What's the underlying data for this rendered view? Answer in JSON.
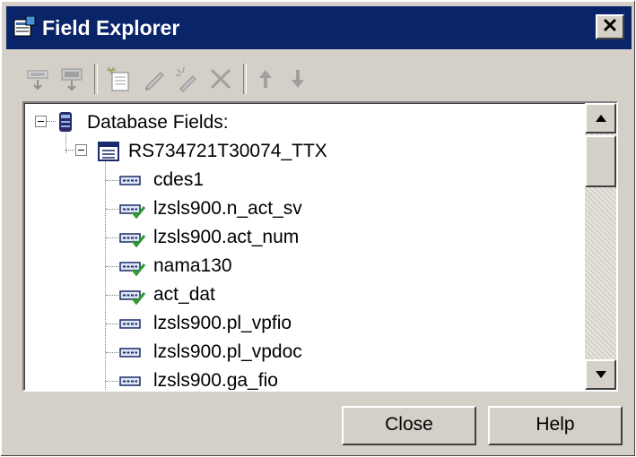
{
  "window": {
    "title": "Field Explorer",
    "close_glyph": "✕"
  },
  "toolbar": {
    "buttons": [
      {
        "name": "insert-field-icon"
      },
      {
        "name": "browse-field-icon"
      },
      {
        "name": "new-formula-icon"
      },
      {
        "name": "edit-icon"
      },
      {
        "name": "rename-icon"
      },
      {
        "name": "delete-icon"
      },
      {
        "name": "move-up-icon"
      },
      {
        "name": "move-down-icon"
      }
    ]
  },
  "tree": {
    "root_label": "Database Fields:",
    "table_label": "RS734721T30074_TTX",
    "fields": [
      {
        "label": "cdes1",
        "checked": false
      },
      {
        "label": "lzsls900.n_act_sv",
        "checked": true
      },
      {
        "label": "lzsls900.act_num",
        "checked": true
      },
      {
        "label": "nama130",
        "checked": true
      },
      {
        "label": "act_dat",
        "checked": true
      },
      {
        "label": "lzsls900.pl_vpfio",
        "checked": false
      },
      {
        "label": "lzsls900.pl_vpdoc",
        "checked": false
      },
      {
        "label": "lzsls900.ga_fio",
        "checked": false
      }
    ]
  },
  "buttons": {
    "close_label": "Close",
    "help_label": "Help"
  },
  "colors": {
    "titlebar": "#0a246a",
    "face": "#d4d0c8",
    "check": "#2e9a2e"
  }
}
